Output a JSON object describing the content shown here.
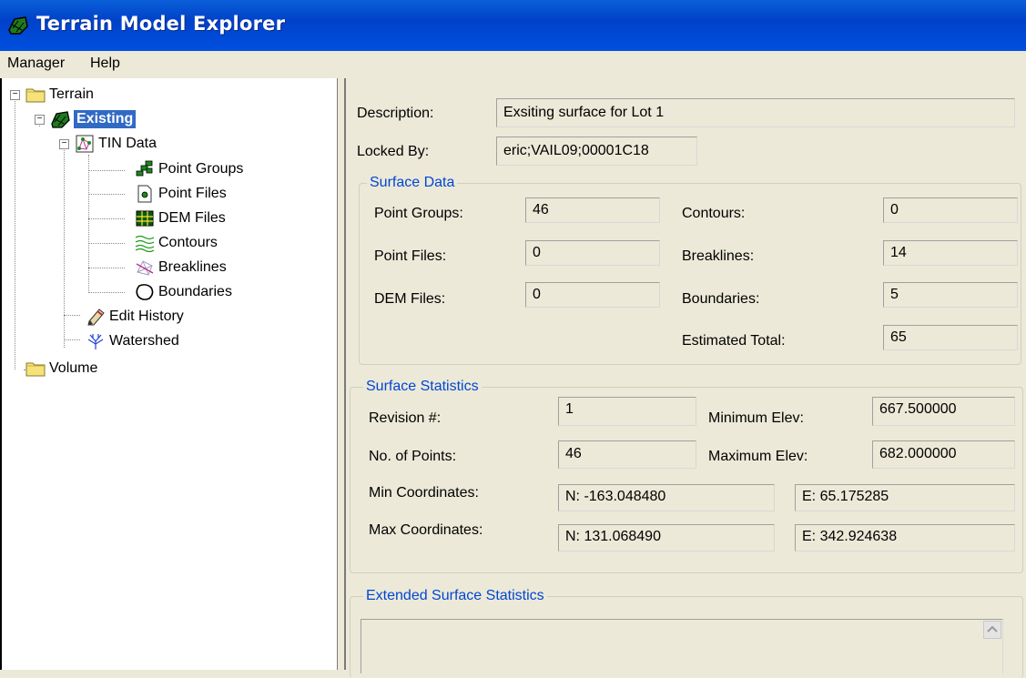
{
  "window": {
    "title": "Terrain Model Explorer"
  },
  "menu": {
    "items": [
      "Manager",
      "Help"
    ]
  },
  "tree": {
    "root": "Terrain",
    "existing": "Existing",
    "tin_data": "TIN Data",
    "point_groups": "Point Groups",
    "point_files": "Point Files",
    "dem_files": "DEM Files",
    "contours": "Contours",
    "breaklines": "Breaklines",
    "boundaries": "Boundaries",
    "edit_history": "Edit History",
    "watershed": "Watershed",
    "volume": "Volume"
  },
  "details": {
    "description_label": "Description:",
    "description_value": "Exsiting surface for Lot 1",
    "locked_label": "Locked By:",
    "locked_value": "eric;VAIL09;00001C18"
  },
  "surface_data": {
    "title": "Surface Data",
    "point_groups_label": "Point Groups:",
    "point_groups_value": "46",
    "point_files_label": "Point Files:",
    "point_files_value": "0",
    "dem_files_label": "DEM Files:",
    "dem_files_value": "0",
    "contours_label": "Contours:",
    "contours_value": "0",
    "breaklines_label": "Breaklines:",
    "breaklines_value": "14",
    "boundaries_label": "Boundaries:",
    "boundaries_value": "5",
    "estimated_total_label": "Estimated Total:",
    "estimated_total_value": "65"
  },
  "surface_stats": {
    "title": "Surface Statistics",
    "revision_label": "Revision #:",
    "revision_value": "1",
    "num_points_label": "No. of Points:",
    "num_points_value": "46",
    "min_elev_label": "Minimum Elev:",
    "min_elev_value": "667.500000",
    "max_elev_label": "Maximum Elev:",
    "max_elev_value": "682.000000",
    "min_coords_label": "Min Coordinates:",
    "min_n_value": "N: -163.048480",
    "min_e_value": "E: 65.175285",
    "max_coords_label": "Max Coordinates:",
    "max_n_value": "N: 131.068490",
    "max_e_value": "E: 342.924638"
  },
  "extended_stats": {
    "title": "Extended Surface Statistics"
  },
  "colors": {
    "title_bar": "#0041c9",
    "selection": "#316ac5",
    "group_title": "#0046d5",
    "background": "#ece9d8"
  }
}
